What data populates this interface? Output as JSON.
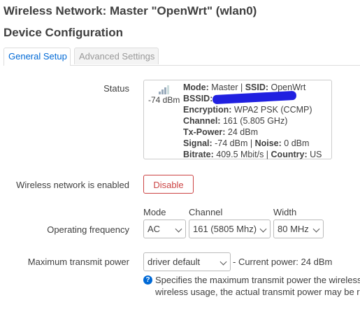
{
  "header": {
    "title": "Wireless Network: Master \"OpenWrt\" (wlan0)",
    "section": "Device Configuration"
  },
  "tabs": [
    {
      "label": "General Setup",
      "active": true
    },
    {
      "label": "Advanced Settings",
      "active": false
    }
  ],
  "status": {
    "label": "Status",
    "signal_dbm": "-74 dBm",
    "mode_key": "Mode:",
    "mode_val": " Master | ",
    "ssid_key": "SSID:",
    "ssid_val": " OpenWrt",
    "bssid_key": "BSSID:",
    "encryption_key": "Encryption:",
    "encryption_val": " WPA2 PSK (CCMP)",
    "channel_key": "Channel:",
    "channel_val": " 161 (5.805 GHz)",
    "txpower_key": "Tx-Power:",
    "txpower_val": " 24 dBm",
    "signal_key": "Signal:",
    "signal_val": " -74 dBm | ",
    "noise_key": "Noise:",
    "noise_val": " 0 dBm",
    "bitrate_key": "Bitrate:",
    "bitrate_val": " 409.5 Mbit/s | ",
    "country_key": "Country:",
    "country_val": " US"
  },
  "enabled": {
    "label": "Wireless network is enabled",
    "button": "Disable"
  },
  "frequency": {
    "label": "Operating frequency",
    "mode_header": "Mode",
    "channel_header": "Channel",
    "width_header": "Width",
    "mode_value": "AC",
    "channel_value": "161 (5805 Mhz)",
    "width_value": "80 MHz"
  },
  "txpower": {
    "label": "Maximum transmit power",
    "value": "driver default",
    "current": "- Current power: 24 dBm",
    "help_line1": "Specifies the maximum transmit power the wireless",
    "help_line2": "wireless usage, the actual transmit power may be r"
  },
  "colors": {
    "accent": "#0069d6",
    "danger": "#cc4444",
    "redaction": "#2020e0"
  }
}
